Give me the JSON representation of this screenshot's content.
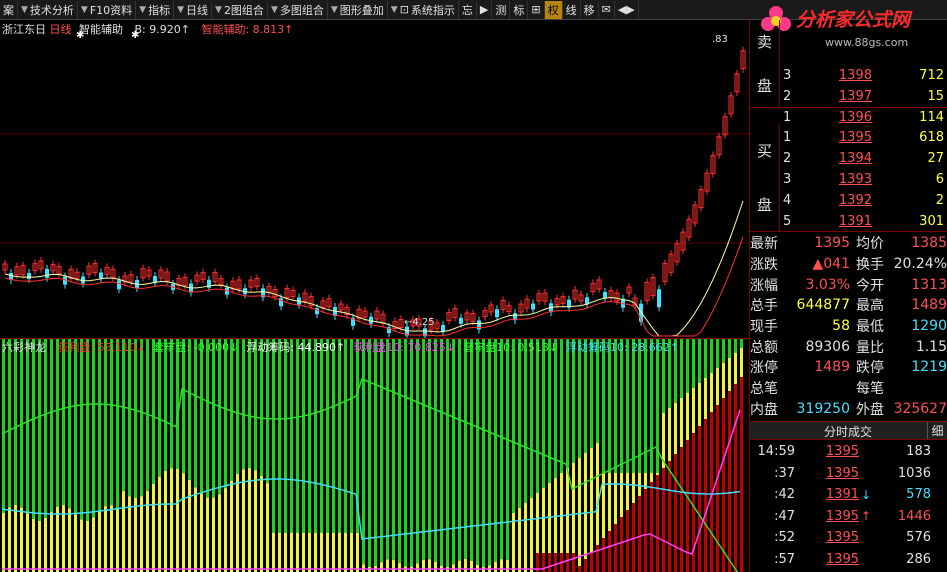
{
  "toolbar": {
    "items": [
      {
        "label": "案",
        "arrow": false,
        "icon": false
      },
      {
        "label": "技术分析",
        "arrow": true,
        "icon": false
      },
      {
        "label": "F10资料",
        "arrow": true,
        "icon": false
      },
      {
        "label": "指标",
        "arrow": true,
        "icon": false
      },
      {
        "label": "日线",
        "arrow": true,
        "icon": false
      },
      {
        "label": "2图组合",
        "arrow": true,
        "icon": false
      },
      {
        "label": "多图组合",
        "arrow": true,
        "icon": false
      },
      {
        "label": "图形叠加",
        "arrow": true,
        "icon": false
      },
      {
        "label": "系统指示",
        "arrow": true,
        "icon": true
      },
      {
        "label": "忘",
        "arrow": false,
        "icon": false
      },
      {
        "label": "▶",
        "arrow": false,
        "icon": false
      },
      {
        "label": "测",
        "arrow": false,
        "icon": false
      },
      {
        "label": "标",
        "arrow": false,
        "icon": false
      },
      {
        "label": "⊞",
        "arrow": false,
        "icon": false
      },
      {
        "label": "权",
        "arrow": false,
        "icon": false,
        "active": true
      },
      {
        "label": "线",
        "arrow": false,
        "icon": false
      },
      {
        "label": "移",
        "arrow": false,
        "icon": false
      },
      {
        "label": "✉",
        "arrow": false,
        "icon": false
      },
      {
        "label": "◀▶",
        "arrow": false,
        "icon": false
      }
    ]
  },
  "logo": {
    "text": "分析家公式网",
    "url": "www.88gs.com"
  },
  "main_chart": {
    "stock": "浙江东日",
    "period": "日线",
    "indicator": "智能辅助",
    "b_label": "B: 9.920↑",
    "ind_label": "智能辅助: 8.813↑",
    "low_label": "4.25",
    "high_label": ".83"
  },
  "sub_chart": {
    "name": "六彩神龙",
    "lines": [
      {
        "text": "获利盘: 55.110↓",
        "color": "#ff3030"
      },
      {
        "text": "套牢盘: -0.000↓",
        "color": "#30ff30"
      },
      {
        "text": "浮动筹码: 44.890↑",
        "color": "#ffffff"
      },
      {
        "text": "获利盘10: 70.825↓",
        "color": "#ff40ff"
      },
      {
        "text": "套牢盘10: 0.513↓",
        "color": "#30ff30"
      },
      {
        "text": "浮动筹码10: 28.662↑",
        "color": "#40e0ff"
      }
    ]
  },
  "orderbook": {
    "sell_label": [
      "卖",
      "盘"
    ],
    "sell": [
      {
        "lv": "3",
        "price": "1398",
        "vol": "712"
      },
      {
        "lv": "2",
        "price": "1397",
        "vol": "15"
      },
      {
        "lv": "1",
        "price": "1396",
        "vol": "114"
      }
    ],
    "buy_label": [
      "买",
      "盘"
    ],
    "buy": [
      {
        "lv": "1",
        "price": "1395",
        "vol": "618"
      },
      {
        "lv": "2",
        "price": "1394",
        "vol": "27"
      },
      {
        "lv": "3",
        "price": "1393",
        "vol": "6"
      },
      {
        "lv": "4",
        "price": "1392",
        "vol": "2"
      },
      {
        "lv": "5",
        "price": "1391",
        "vol": "301"
      }
    ]
  },
  "quote": {
    "rows": [
      {
        "l": "最新",
        "v": "1395",
        "vc": "red",
        "l2": "均价",
        "v2": "1385",
        "v2c": "red"
      },
      {
        "l": "涨跌",
        "v": "▲041",
        "vc": "red",
        "l2": "换手",
        "v2": "20.24%",
        "v2c": "white"
      },
      {
        "l": "涨幅",
        "v": "3.03%",
        "vc": "red",
        "l2": "今开",
        "v2": "1313",
        "v2c": "red"
      },
      {
        "l": "总手",
        "v": "644877",
        "vc": "yel",
        "l2": "最高",
        "v2": "1489",
        "v2c": "red"
      },
      {
        "l": "现手",
        "v": "58",
        "vc": "yel",
        "l2": "最低",
        "v2": "1290",
        "v2c": "cyan"
      },
      {
        "l": "总额",
        "v": "89306",
        "vc": "white",
        "l2": "量比",
        "v2": "1.15",
        "v2c": "white"
      },
      {
        "l": "涨停",
        "v": "1489",
        "vc": "red",
        "l2": "跌停",
        "v2": "1219",
        "v2c": "cyan"
      },
      {
        "l": "总笔",
        "v": "",
        "vc": "white",
        "l2": "每笔",
        "v2": "",
        "v2c": "white"
      },
      {
        "l": "内盘",
        "v": "319250",
        "vc": "cyan",
        "l2": "外盘",
        "v2": "325627",
        "v2c": "red"
      }
    ]
  },
  "ticks": {
    "title": "分时成交",
    "detail": "细",
    "rows": [
      {
        "time": "14:59",
        "price": "1395",
        "arrow": "",
        "vol": "183",
        "vc": "white"
      },
      {
        "time": ":37",
        "price": "1395",
        "arrow": "",
        "vol": "1036",
        "vc": "white"
      },
      {
        "time": ":42",
        "price": "1391",
        "arrow": "↓",
        "ac": "cyan",
        "vol": "578",
        "vc": "cyan"
      },
      {
        "time": ":47",
        "price": "1395",
        "arrow": "↑",
        "ac": "red",
        "vol": "1446",
        "vc": "red"
      },
      {
        "time": ":52",
        "price": "1395",
        "arrow": "",
        "vol": "576",
        "vc": "white"
      },
      {
        "time": ":57",
        "price": "1395",
        "arrow": "",
        "vol": "286",
        "vc": "white"
      }
    ]
  },
  "colors": {
    "up": "#ff3030",
    "down": "#40e0ff",
    "ma1": "#ffffa0",
    "ma2": "#ff3030",
    "green": "#20d020",
    "yellow": "#f0f040",
    "red": "#c00000"
  }
}
